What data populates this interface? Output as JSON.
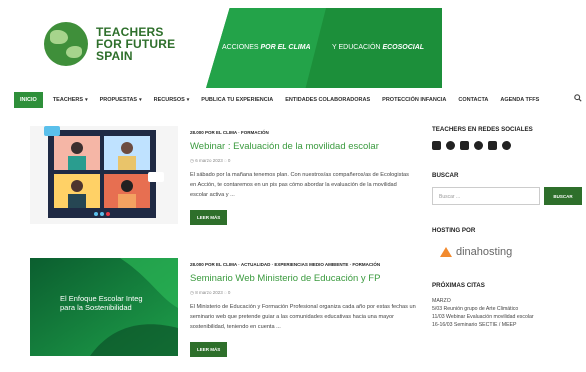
{
  "header": {
    "logo_line1": "TEACHERS",
    "logo_line2": "FOR FUTURE",
    "logo_line3": "SPAIN",
    "banner_left_prefix": "ACCIONES ",
    "banner_left_emph": "POR EL CLIMA",
    "banner_right_prefix": "Y EDUCACIÓN ",
    "banner_right_emph": "ECOSOCIAL"
  },
  "nav": {
    "items": [
      {
        "label": "INICIO",
        "active": true
      },
      {
        "label": "TEACHERS",
        "caret": true
      },
      {
        "label": "PROPUESTAS",
        "caret": true
      },
      {
        "label": "RECURSOS",
        "caret": true
      },
      {
        "label": "PUBLICA TU EXPERIENCIA"
      },
      {
        "label": "ENTIDADES COLABORADORAS"
      },
      {
        "label": "PROTECCIÓN INFANCIA"
      },
      {
        "label": "CONTACTA"
      },
      {
        "label": "AGENDA TFFS"
      }
    ],
    "search_icon": "search-icon"
  },
  "posts": [
    {
      "categories": "28.000 POR EL CLIMA · FORMACIÓN",
      "title": "Webinar : Evaluación de la movilidad escolar",
      "meta": "6 marzo 2023",
      "excerpt": "El sábado por la mañana tenemos plan. Con nuestros/as compañeros/as de Ecologistas en Acción, te contaremos en un pis pas cómo abordar la evaluación de la movilidad escolar activa y ...",
      "readmore": "LEER MÁS"
    },
    {
      "categories": "28.000 POR EL CLIMA · ACTUALIDAD · EXPERIENCIAS MEDIO AMBIENTE · FORMACIÓN",
      "title": "Seminario Web Ministerio de Educación y FP",
      "meta": "8 marzo 2023",
      "excerpt": "El Ministerio de Educación y Formación Profesional organiza cada año por estas fechas un seminario web que pretende guiar a las comunidades educativas hacia una mayor sostenibilidad, teniendo en cuenta ...",
      "readmore": "LEER MÁS",
      "thumb_text_line1": "El Enfoque Escolar Integ",
      "thumb_text_line2": "para la Sostenibilidad"
    }
  ],
  "sidebar": {
    "social_title": "TEACHERS EN REDES SOCIALES",
    "social_icons": [
      "youtube-icon",
      "instagram-icon",
      "twitter-icon",
      "github-icon",
      "linkedin-icon",
      "telegram-icon"
    ],
    "search_title": "BUSCAR",
    "search_placeholder": "Buscar ...",
    "search_button": "BUSCAR",
    "hosting_title": "HOSTING POR",
    "hosting_brand": "dinahosting",
    "citas_title": "PRÓXIMAS CITAS",
    "citas": [
      "MARZO",
      "5/03 Reunión grupo de Arte Climático",
      "11/03 Webinar Evaluación movilidad escolar",
      "16-16/03 Seminario SECTIE / MEEP"
    ]
  },
  "colors": {
    "brand_green": "#2e6f2b",
    "accent_green": "#3a9a3e",
    "banner_green": "#1c8f3a",
    "hosting_orange": "#f28a2e"
  }
}
